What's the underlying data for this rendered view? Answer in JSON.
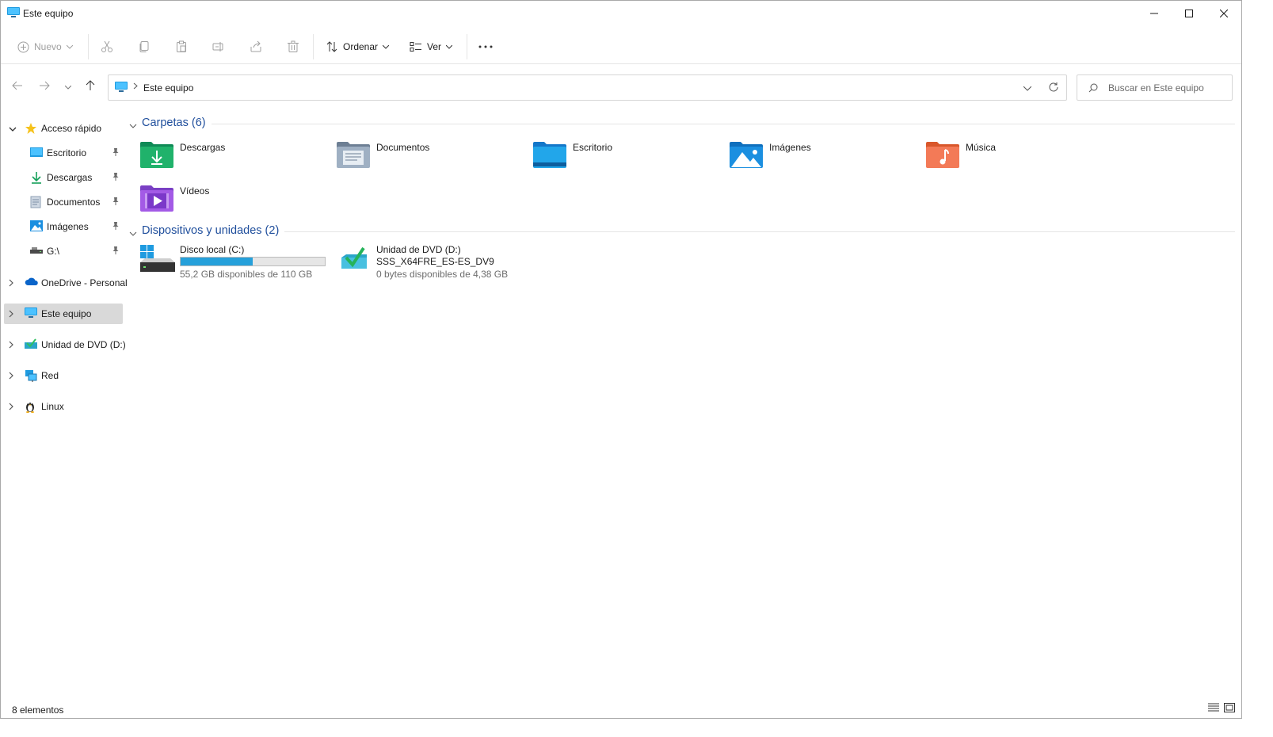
{
  "window": {
    "title": "Este equipo"
  },
  "toolbar": {
    "new_label": "Nuevo",
    "sort_label": "Ordenar",
    "view_label": "Ver",
    "more_label": "···"
  },
  "address": {
    "crumb": "Este equipo",
    "search_placeholder": "Buscar en Este equipo"
  },
  "nav": {
    "quick_access": "Acceso rápido",
    "quick_items": [
      {
        "label": "Escritorio",
        "icon": "desktop-icon"
      },
      {
        "label": "Descargas",
        "icon": "download-icon"
      },
      {
        "label": "Documentos",
        "icon": "documents-icon"
      },
      {
        "label": "Imágenes",
        "icon": "pictures-icon"
      },
      {
        "label": "G:\\",
        "icon": "drive-icon"
      }
    ],
    "onedrive": "OneDrive - Personal",
    "this_pc": "Este equipo",
    "dvd": "Unidad de DVD (D:)",
    "network": "Red",
    "linux": "Linux"
  },
  "sections": {
    "folders_title": "Carpetas (6)",
    "devices_title": "Dispositivos y unidades (2)"
  },
  "folders": [
    {
      "label": "Descargas",
      "icon": "downloads-folder-icon"
    },
    {
      "label": "Documentos",
      "icon": "documents-folder-icon"
    },
    {
      "label": "Escritorio",
      "icon": "desktop-folder-icon"
    },
    {
      "label": "Imágenes",
      "icon": "pictures-folder-icon"
    },
    {
      "label": "Música",
      "icon": "music-folder-icon"
    },
    {
      "label": "Vídeos",
      "icon": "videos-folder-icon"
    }
  ],
  "drives": {
    "c": {
      "name": "Disco local (C:)",
      "free": "55,2 GB disponibles de 110 GB",
      "used_fraction": 0.5
    },
    "d": {
      "name": "Unidad de DVD (D:)",
      "volume": "SSS_X64FRE_ES-ES_DV9",
      "free": "0 bytes disponibles de 4,38 GB"
    }
  },
  "status": {
    "items": "8 elementos"
  },
  "colors": {
    "accent": "#26a0da",
    "section_title": "#1f4e9c",
    "selected_bg": "#d9d9d9"
  }
}
